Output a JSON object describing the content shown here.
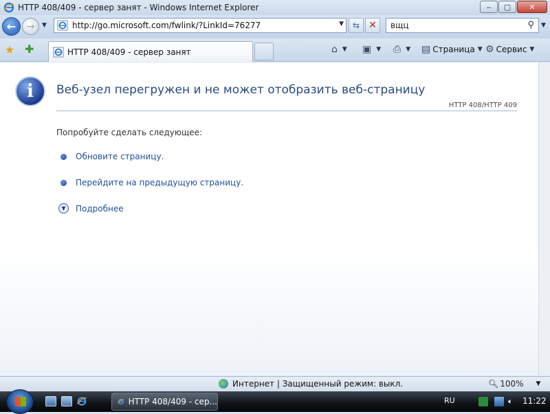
{
  "window": {
    "title": "HTTP 408/409 - сервер занят - Windows Internet Explorer",
    "controls": {
      "minimize": "‒",
      "maximize": "▢",
      "close": "✕"
    }
  },
  "nav": {
    "back_icon": "back-arrow-icon",
    "forward_icon": "forward-arrow-icon",
    "address": "http://go.microsoft.com/fwlink/?LinkId=76277",
    "search_value": "вщц",
    "search_placeholder": ""
  },
  "tabs": [
    {
      "label": "HTTP 408/409 - сервер занят",
      "active": true
    }
  ],
  "command_bar": {
    "page_label": "Страница",
    "tools_label": "Сервис"
  },
  "page": {
    "title": "Веб-узел перегружен и не может отобразить веб-страницу",
    "code": "HTTP 408/HTTP 409",
    "try_text": "Попробуйте сделать следующее:",
    "options": [
      "Обновите страницу.",
      "Перейдите на предыдущую страницу."
    ],
    "more_label": "Подробнее"
  },
  "status": {
    "zone": "Интернет | Защищенный режим: выкл.",
    "zoom": "100%"
  },
  "taskbar": {
    "task_label": "HTTP 408/409 - сер...",
    "language": "RU",
    "clock": "11:22"
  },
  "colors": {
    "link": "#1f4f99",
    "title_text": "#2a4a80",
    "close_button": "#c7453a"
  }
}
